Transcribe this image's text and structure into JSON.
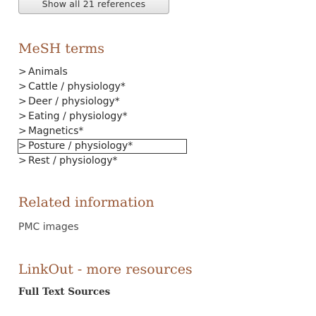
{
  "references": {
    "show_all_label": "Show all 21 references"
  },
  "mesh": {
    "title": "MeSH terms",
    "items": [
      {
        "chevron": ">",
        "label": "Animals"
      },
      {
        "chevron": ">",
        "label": "Cattle / physiology*"
      },
      {
        "chevron": ">",
        "label": "Deer / physiology*"
      },
      {
        "chevron": ">",
        "label": "Eating / physiology*"
      },
      {
        "chevron": ">",
        "label": "Magnetics*"
      },
      {
        "chevron": ">",
        "label": "Posture / physiology*"
      },
      {
        "chevron": ">",
        "label": "Rest / physiology*"
      }
    ]
  },
  "related": {
    "title": "Related information",
    "pmc_images": "PMC images"
  },
  "linkout": {
    "title": "LinkOut - more resources",
    "full_text_sources": "Full Text Sources"
  }
}
